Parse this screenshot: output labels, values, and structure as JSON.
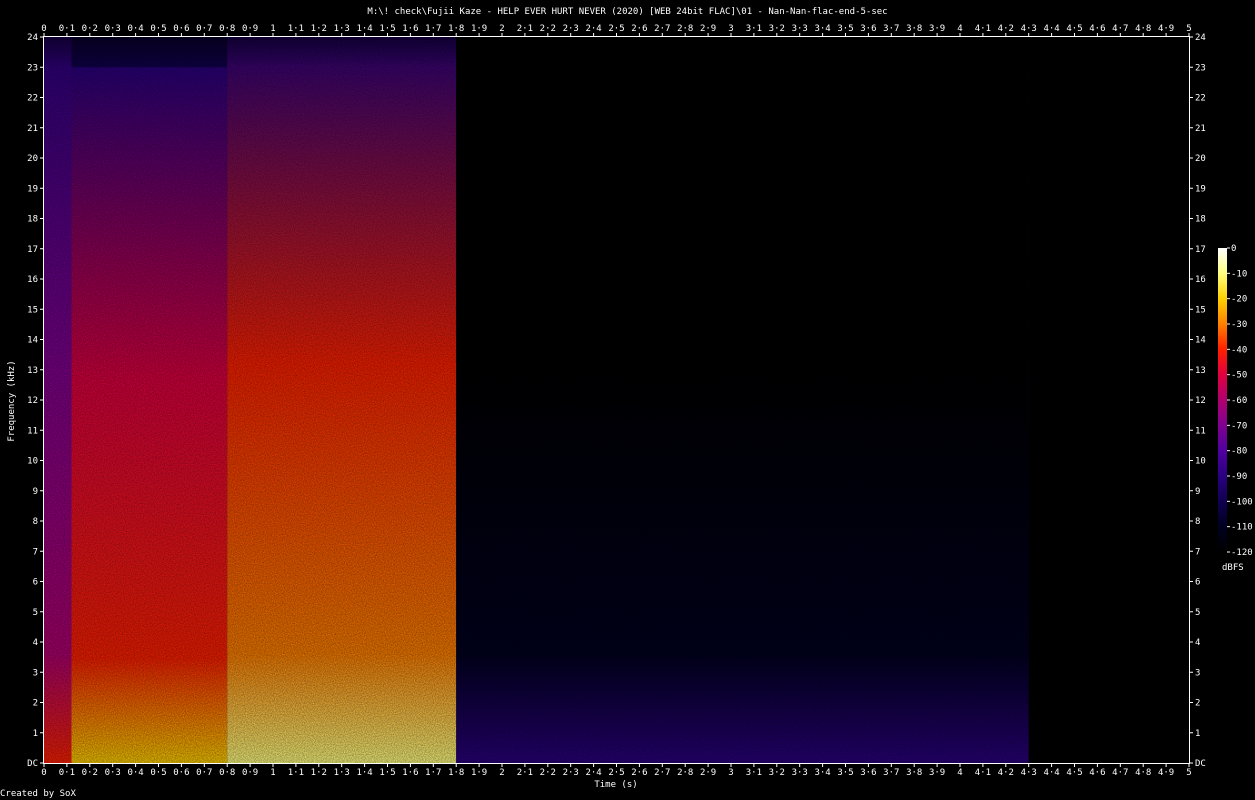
{
  "chart_data": {
    "type": "heatmap",
    "title": "M:\\! check\\Fujii Kaze - HELP EVER HURT NEVER (2020) [WEB 24bit FLAC]\\01 - Nan-Nan-flac-end-5-sec",
    "xlabel": "Time (s)",
    "ylabel": "Frequency (kHz)",
    "xlim": [
      0,
      5
    ],
    "ylim": [
      0,
      24
    ],
    "x_ticks": [
      "0",
      "0·1",
      "0·2",
      "0·3",
      "0·4",
      "0·5",
      "0·6",
      "0·7",
      "0·8",
      "0·9",
      "1",
      "1·1",
      "1·2",
      "1·3",
      "1·4",
      "1·5",
      "1·6",
      "1·7",
      "1·8",
      "1·9",
      "2",
      "2·1",
      "2·2",
      "2·3",
      "2·4",
      "2·5",
      "2·6",
      "2·7",
      "2·8",
      "2·9",
      "3",
      "3·1",
      "3·2",
      "3·3",
      "3·4",
      "3·5",
      "3·6",
      "3·7",
      "3·8",
      "3·9",
      "4",
      "4·1",
      "4·2",
      "4·3",
      "4·4",
      "4·5",
      "4·6",
      "4·7",
      "4·8",
      "4·9",
      "5"
    ],
    "y_ticks": [
      "DC",
      "1",
      "2",
      "3",
      "4",
      "5",
      "6",
      "7",
      "8",
      "9",
      "10",
      "11",
      "12",
      "13",
      "14",
      "15",
      "16",
      "17",
      "18",
      "19",
      "20",
      "21",
      "22",
      "23",
      "24"
    ],
    "colorbar": {
      "unit": "dBFS",
      "range": [
        -120,
        0
      ],
      "ticks": [
        "0",
        "-10",
        "-20",
        "-30",
        "-40",
        "-50",
        "-60",
        "-70",
        "-80",
        "-90",
        "-100",
        "-110",
        "-120"
      ],
      "colors": [
        "#ffffff",
        "#ffff80",
        "#ffd000",
        "#ff8000",
        "#ff2000",
        "#e00040",
        "#b00070",
        "#800090",
        "#5000a0",
        "#2a0080",
        "#100050",
        "#000020",
        "#000000"
      ]
    },
    "events": [
      {
        "start": 0.0,
        "end": 0.12,
        "max_freq_khz": 24,
        "peak_dbfs": -40
      },
      {
        "start": 0.12,
        "end": 0.8,
        "max_freq_khz": 23,
        "peak_dbfs": -20
      },
      {
        "start": 0.8,
        "end": 1.8,
        "max_freq_khz": 24,
        "peak_dbfs": -10
      },
      {
        "start": 1.8,
        "end": 4.3,
        "max_freq_khz": 24,
        "peak_dbfs": -90
      },
      {
        "start": 4.3,
        "end": 5.0,
        "max_freq_khz": 24,
        "peak_dbfs": -120
      }
    ]
  },
  "footer": "Created by SoX"
}
